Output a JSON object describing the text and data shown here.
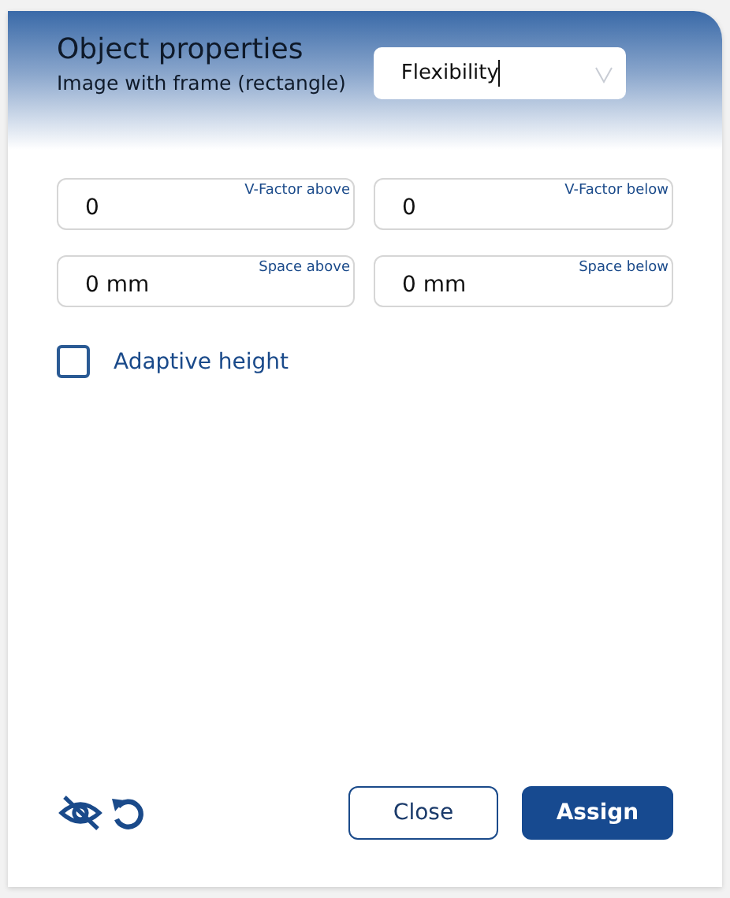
{
  "dialog": {
    "title": "Object properties",
    "subtitle": "Image with frame (rectangle)"
  },
  "dropdown": {
    "value": "Flexibility"
  },
  "fields": [
    {
      "value": "0",
      "label": "V-Factor above"
    },
    {
      "value": "0",
      "label": "V-Factor below"
    },
    {
      "value": "0 mm",
      "label": "Space above"
    },
    {
      "value": "0 mm",
      "label": "Space below"
    }
  ],
  "checkbox": {
    "label": "Adaptive height",
    "checked": false
  },
  "buttons": [
    {
      "label": "Close",
      "kind": "secondary"
    },
    {
      "label": "Assign",
      "kind": "primary"
    }
  ]
}
